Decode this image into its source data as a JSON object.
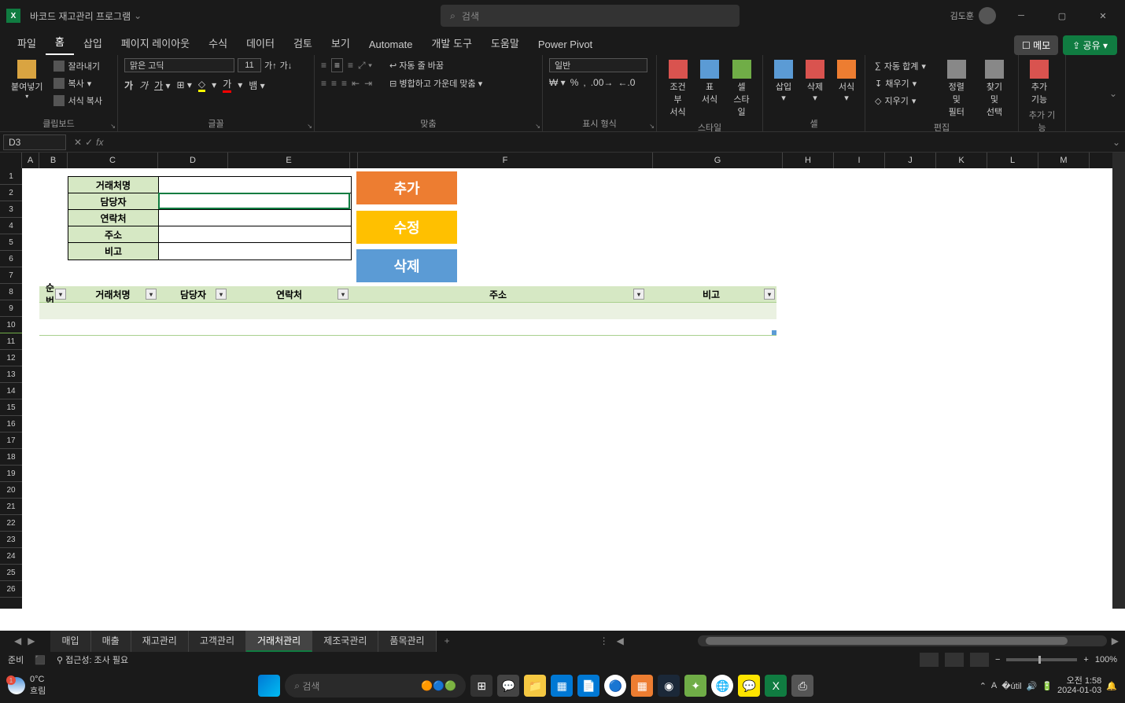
{
  "titlebar": {
    "app_title": "바코드 재고관리 프로그램",
    "search_placeholder": "검색",
    "user_name": "김도훈"
  },
  "menu": {
    "tabs": [
      "파일",
      "홈",
      "삽입",
      "페이지 레이아웃",
      "수식",
      "데이터",
      "검토",
      "보기",
      "Automate",
      "개발 도구",
      "도움말",
      "Power Pivot"
    ],
    "memo": "메모",
    "share": "공유"
  },
  "ribbon": {
    "paste": "붙여넣기",
    "cut": "잘라내기",
    "copy": "복사",
    "format_painter": "서식 복사",
    "clipboard_label": "클립보드",
    "font_name": "맑은 고딕",
    "font_size": "11",
    "font_label": "글꼴",
    "wrap": "자동 줄 바꿈",
    "merge": "병합하고 가운데 맞춤",
    "alignment_label": "맞춤",
    "number_format": "일반",
    "number_label": "표시 형식",
    "cond_format": "조건부\n서식",
    "table_format": "표\n서식",
    "cell_style": "셀\n스타일",
    "styles_label": "스타일",
    "insert": "삽입",
    "delete": "삭제",
    "format": "서식",
    "cells_label": "셀",
    "autosum": "자동 합계",
    "fill": "채우기",
    "clear": "지우기",
    "sort_filter": "정렬 및\n필터",
    "find_select": "찾기 및\n선택",
    "editing_label": "편집",
    "addins": "추가\n기능",
    "addins_label": "추가 기능"
  },
  "formula": {
    "cell_ref": "D3"
  },
  "columns": [
    "A",
    "B",
    "C",
    "D",
    "E",
    "F",
    "G",
    "H",
    "I",
    "J",
    "K",
    "L",
    "M"
  ],
  "form": {
    "labels": [
      "거래처명",
      "담당자",
      "연락처",
      "주소",
      "비고"
    ]
  },
  "buttons": {
    "add": "추가",
    "edit": "수정",
    "delete": "삭제"
  },
  "table": {
    "headers": [
      "순번",
      "거래처명",
      "담당자",
      "연락처",
      "주소",
      "비고"
    ]
  },
  "sheets": {
    "tabs": [
      "매입",
      "매출",
      "재고관리",
      "고객관리",
      "거래처관리",
      "제조국관리",
      "품목관리"
    ],
    "active_index": 4
  },
  "status": {
    "ready": "준비",
    "accessibility": "접근성: 조사 필요",
    "zoom": "100%"
  },
  "taskbar": {
    "temp": "0°C",
    "condition": "흐림",
    "search": "검색",
    "time": "오전 1:58",
    "date": "2024-01-03"
  }
}
